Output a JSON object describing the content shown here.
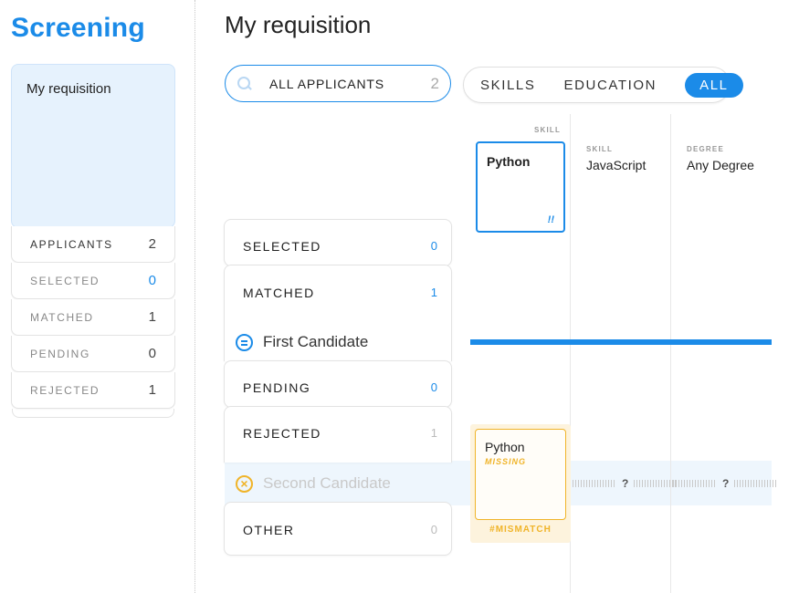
{
  "sidebar": {
    "brand": "Screening",
    "requisition_card": "My requisition",
    "items": [
      {
        "label": "APPLICANTS",
        "count": "2"
      },
      {
        "label": "SELECTED",
        "count": "0"
      },
      {
        "label": "MATCHED",
        "count": "1"
      },
      {
        "label": "PENDING",
        "count": "0"
      },
      {
        "label": "REJECTED",
        "count": "1"
      }
    ]
  },
  "main": {
    "title": "My requisition",
    "search": {
      "value": "ALL APPLICANTS",
      "count": "2"
    },
    "tabs": [
      {
        "label": "SKILLS",
        "active": false
      },
      {
        "label": "EDUCATION",
        "active": false
      },
      {
        "label": "ALL",
        "active": true
      }
    ],
    "statuses": [
      {
        "label": "SELECTED",
        "count": "0"
      },
      {
        "label": "MATCHED",
        "count": "1"
      },
      {
        "label": "PENDING",
        "count": "0"
      },
      {
        "label": "REJECTED",
        "count": "1"
      },
      {
        "label": "OTHER",
        "count": "0"
      }
    ],
    "candidates": [
      {
        "name": "First Candidate",
        "icon": "equal-circle-icon"
      },
      {
        "name": "Second Candidate",
        "icon": "x-circle-icon"
      }
    ],
    "criteria": [
      {
        "type": "SKILL",
        "name": "Python",
        "marker": "!!"
      },
      {
        "type": "SKILL",
        "name": "JavaScript"
      },
      {
        "type": "DEGREE",
        "name": "Any Degree"
      }
    ],
    "second_candidate_cells": {
      "python": {
        "name": "Python",
        "status": "MISSING",
        "tag": "#MISMATCH"
      },
      "javascript": "?",
      "degree": "?"
    }
  },
  "colors": {
    "accent": "#1b8be8",
    "warning": "#f0b429",
    "panel": "#e6f2fd"
  }
}
